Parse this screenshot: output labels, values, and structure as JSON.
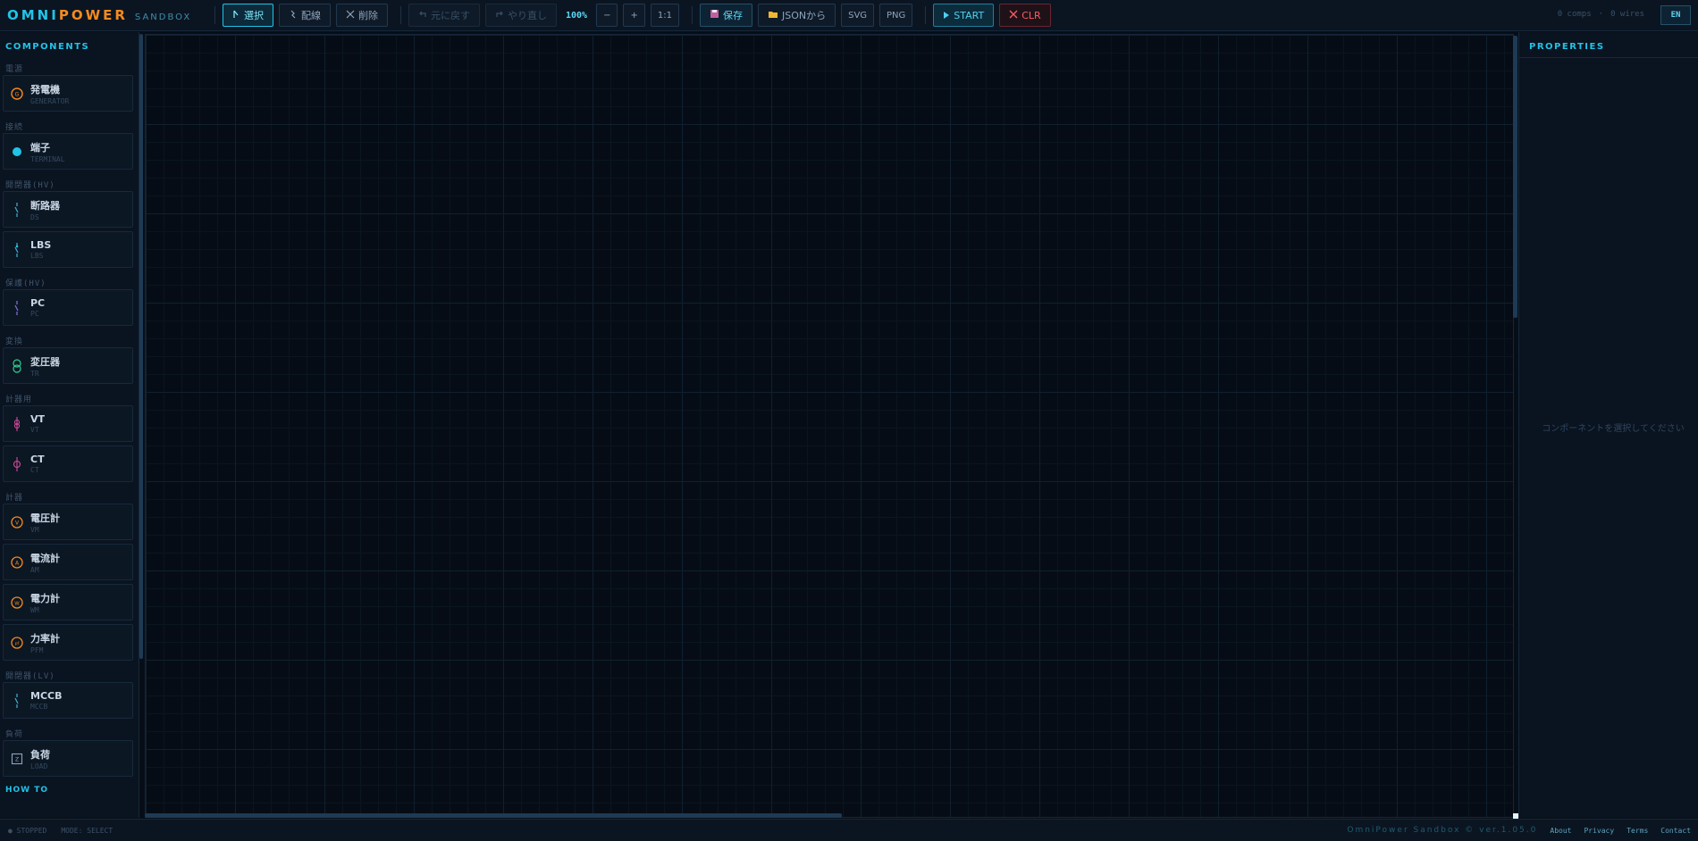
{
  "brand": {
    "name_a": "OMNI",
    "name_b": "POWER",
    "sub": "SANDBOX"
  },
  "toolbar": {
    "select": "選択",
    "wire": "配線",
    "delete": "削除",
    "undo": "元に戻す",
    "redo": "やり直し",
    "zoom": "100%",
    "zoom_out": "−",
    "zoom_in": "+",
    "reset": "1:1",
    "save": "保存",
    "from_json": "JSONから",
    "svg": "SVG",
    "png": "PNG",
    "start": "START",
    "clear": "CLR",
    "comps": "0 comps",
    "wires": "0 wires",
    "lang": "EN"
  },
  "left_panel": {
    "title": "COMPONENTS",
    "cat_power": "電源",
    "generator": {
      "name": "発電機",
      "code": "GENERATOR"
    },
    "cat_connect": "接続",
    "terminal": {
      "name": "端子",
      "code": "TERMINAL"
    },
    "cat_switch_hv": "開閉器(HV)",
    "ds": {
      "name": "断路器",
      "code": "DS"
    },
    "lbs": {
      "name": "LBS",
      "code": "LBS"
    },
    "cat_protect_hv": "保護(HV)",
    "pc": {
      "name": "PC",
      "code": "PC"
    },
    "cat_transform": "変換",
    "tr": {
      "name": "変圧器",
      "code": "TR"
    },
    "cat_instrument": "計器用",
    "vt": {
      "name": "VT",
      "code": "VT"
    },
    "ct": {
      "name": "CT",
      "code": "CT"
    },
    "cat_meter": "計器",
    "vm": {
      "name": "電圧計",
      "code": "VM"
    },
    "am": {
      "name": "電流計",
      "code": "AM"
    },
    "wm": {
      "name": "電力計",
      "code": "WM"
    },
    "pfm": {
      "name": "力率計",
      "code": "PFM"
    },
    "cat_switch_lv": "開閉器(LV)",
    "mccb": {
      "name": "MCCB",
      "code": "MCCB"
    },
    "cat_load": "負荷",
    "load": {
      "name": "負荷",
      "code": "LOAD"
    },
    "howto": "HOW TO"
  },
  "right_panel": {
    "title": "PROPERTIES",
    "empty": "コンポーネントを選択してください"
  },
  "footer": {
    "status": "● STOPPED",
    "mode": "MODE: SELECT",
    "version": "OmniPower Sandbox © ver.1.05.0",
    "about": "About",
    "privacy": "Privacy",
    "terms": "Terms",
    "contact": "Contact"
  },
  "colors": {
    "accent": "#22c3e6",
    "brand_orange": "#f58a1f",
    "danger": "#ff5a63"
  }
}
